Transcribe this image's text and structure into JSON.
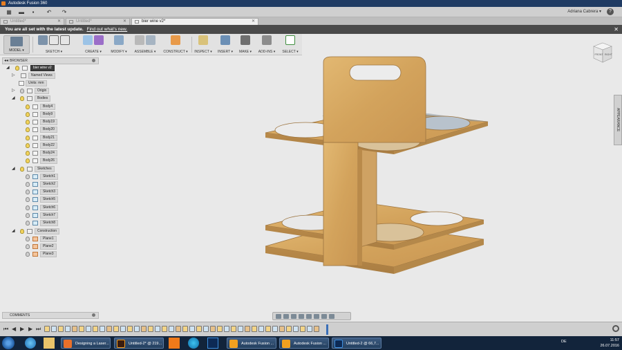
{
  "app": {
    "title": "Autodesk Fusion 360"
  },
  "qat": {
    "user": "Adriana Cabrera ▾",
    "help": "?"
  },
  "tabs": [
    {
      "label": "Untitled*",
      "active": false
    },
    {
      "label": "Untitled*",
      "active": false
    },
    {
      "label": "bier wine v2*",
      "active": true
    }
  ],
  "notification": {
    "text": "You are all set with the latest update.",
    "link": "Find out what's new.",
    "close": "✕"
  },
  "ribbon": {
    "model": "MODEL ▾",
    "groups": [
      {
        "label": "SKETCH ▾"
      },
      {
        "label": "CREATE ▾"
      },
      {
        "label": "MODIFY ▾"
      },
      {
        "label": "ASSEMBLE ▾"
      },
      {
        "label": "CONSTRUCT ▾"
      },
      {
        "label": "INSPECT ▾"
      },
      {
        "label": "INSERT ▾"
      },
      {
        "label": "MAKE ▾"
      },
      {
        "label": "ADD-INS ▾"
      },
      {
        "label": "SELECT ▾"
      }
    ]
  },
  "viewcube": {
    "front": "FRONT",
    "right": "RIGHT"
  },
  "browser": {
    "title": "BROWSER",
    "root": "bier wine v2",
    "named_views": "Named Views",
    "units": "Units: mm",
    "origin": "Origin",
    "bodies_label": "Bodies",
    "bodies": [
      "Body4",
      "Body9",
      "Body19",
      "Body20",
      "Body21",
      "Body22",
      "Body24",
      "Body26"
    ],
    "sketches_label": "Sketches",
    "sketches": [
      "Sketch1",
      "Sketch2",
      "Sketch3",
      "Sketch5",
      "Sketch6",
      "Sketch7",
      "Sketch8"
    ],
    "construction_label": "Construction",
    "planes": [
      "Plane1",
      "Plane2",
      "Plane3"
    ]
  },
  "appearance": "APPEARANCE",
  "comments": {
    "title": "COMMENTS"
  },
  "taskbar": {
    "windows": [
      {
        "label": "Designing a Laser...",
        "color": "#e8702a"
      },
      {
        "label": "Untitled-2* @ 219...",
        "color": "#f29b1d"
      },
      {
        "label": "Autodesk Fusion ...",
        "color": "#f0a020"
      },
      {
        "label": "Autodesk Fusion ...",
        "color": "#f0a020"
      },
      {
        "label": "Untitled-2 @ 66,7...",
        "color": "#2a5fb0"
      }
    ],
    "lang": "DE",
    "time": "11:57",
    "date": "26.07.2016"
  }
}
